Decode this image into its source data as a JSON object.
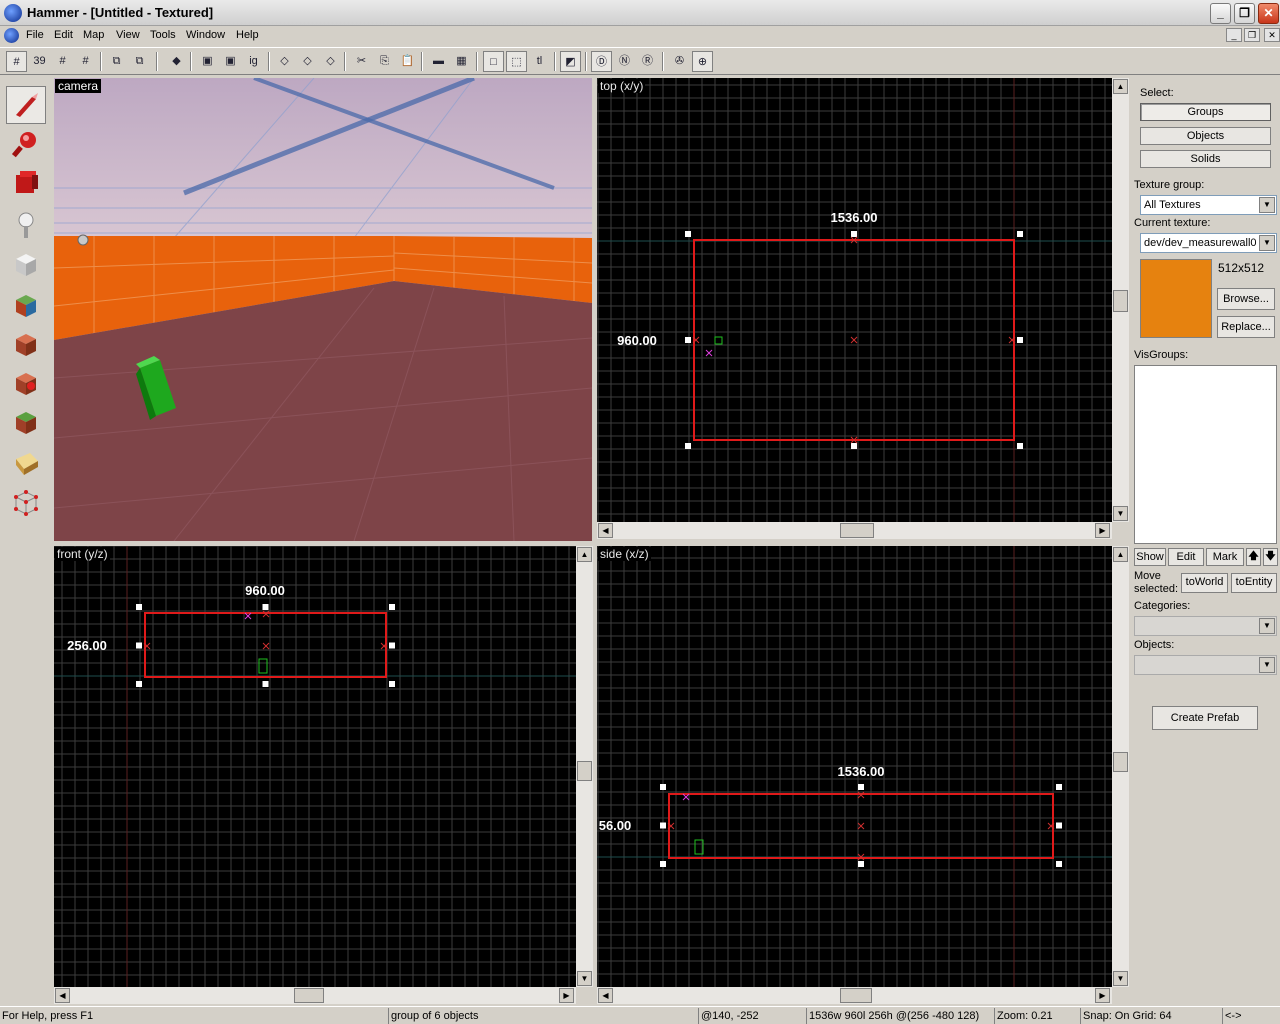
{
  "window": {
    "title": "Hammer - [Untitled - Textured]"
  },
  "menu": [
    "File",
    "Edit",
    "Map",
    "View",
    "Tools",
    "Window",
    "Help"
  ],
  "toolbar": {
    "tooltip_glyphs": [
      "grid",
      "39",
      "#",
      "#*",
      "grp",
      "ungrp",
      "carve",
      "hollow",
      "ig",
      "cut",
      "copy",
      "paste",
      "tex",
      "tl"
    ]
  },
  "palette": [
    "selection-tool",
    "magnify-tool",
    "camera-tool",
    "entity-tool",
    "block-tool",
    "toggle-texture-tool",
    "apply-decal-tool",
    "overlay-tool",
    "clipping-tool",
    "vertex-tool",
    "path-tool"
  ],
  "viewports": {
    "camera": {
      "label": "camera"
    },
    "top": {
      "label": "top (x/y)",
      "width_label": "1536.00",
      "height_label": "960.00"
    },
    "front": {
      "label": "front (y/z)",
      "width_label": "960.00",
      "height_label": "256.00"
    },
    "side": {
      "label": "side (x/z)",
      "width_label": "1536.00",
      "height_label": "56.00"
    }
  },
  "panel": {
    "select_label": "Select:",
    "groups_btn": "Groups",
    "objects_btn": "Objects",
    "solids_btn": "Solids",
    "texture_group_label": "Texture group:",
    "texture_group_value": "All Textures",
    "current_texture_label": "Current texture:",
    "current_texture_value": "dev/dev_measurewall0",
    "texture_size": "512x512",
    "texture_color": "#e6820f",
    "browse_btn": "Browse...",
    "replace_btn": "Replace...",
    "visgroups_label": "VisGroups:",
    "show_btn": "Show",
    "edit_btn": "Edit",
    "mark_btn": "Mark",
    "move_selected_label_1": "Move",
    "move_selected_label_2": "selected:",
    "to_world_btn": "toWorld",
    "to_entity_btn": "toEntity",
    "categories_label": "Categories:",
    "objects_label": "Objects:",
    "create_prefab_btn": "Create Prefab"
  },
  "status": {
    "help": "For Help, press F1",
    "selection": "group of 6 objects",
    "cursor": "@140, -252",
    "size": "1536w 960l 256h @(256 -480 128)",
    "zoom": "Zoom: 0.21",
    "snap": "Snap: On Grid: 64",
    "nav": "<->"
  }
}
